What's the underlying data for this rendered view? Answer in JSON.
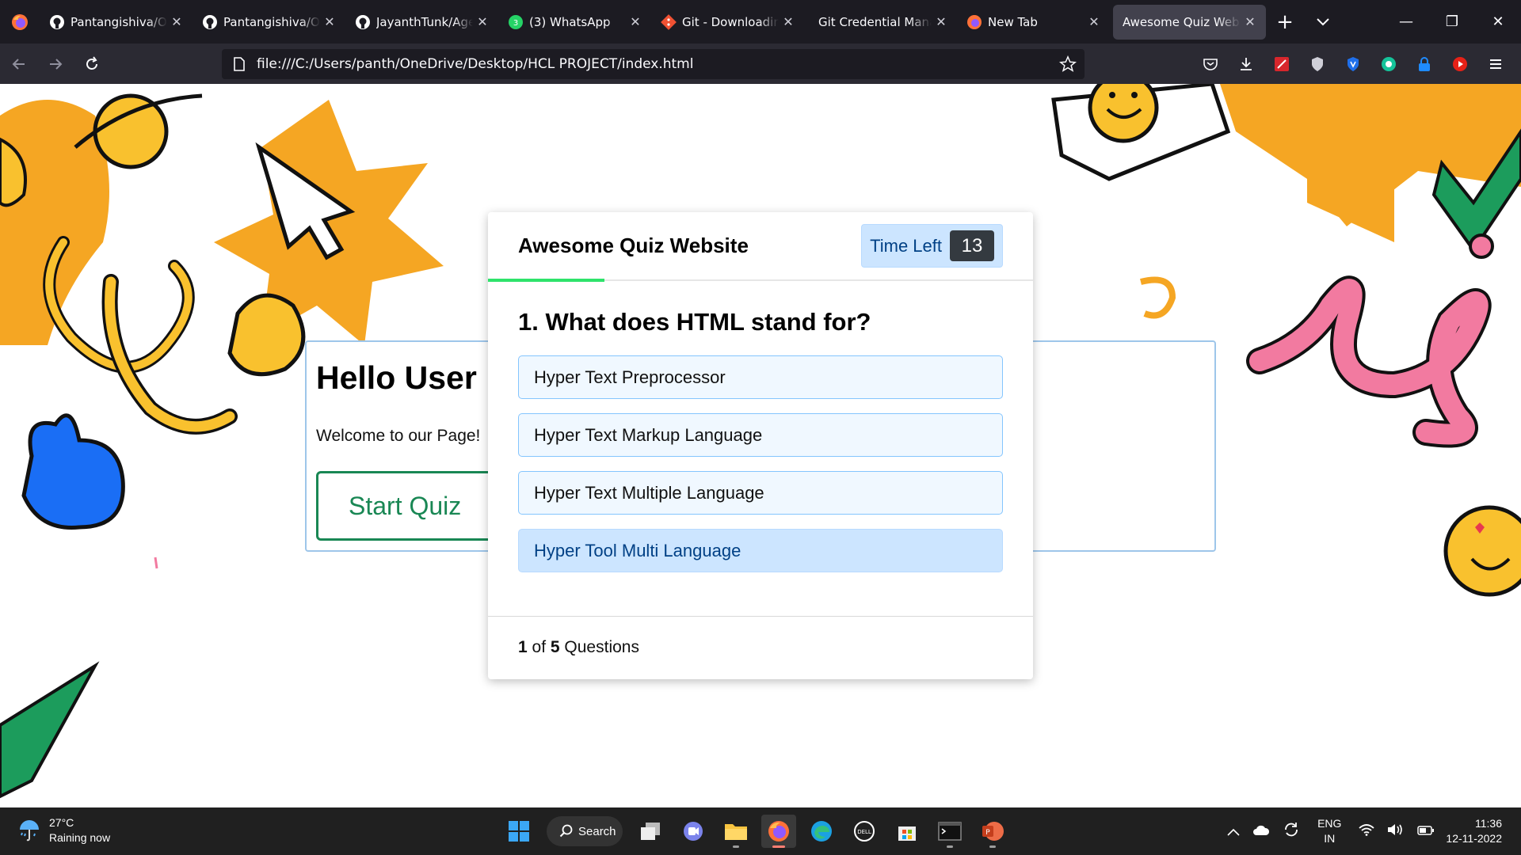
{
  "browser": {
    "tabs": [
      {
        "label": "Pantangishiva/Onl",
        "icon": "github-icon",
        "active": false
      },
      {
        "label": "Pantangishiva/Onl",
        "icon": "github-icon",
        "active": false
      },
      {
        "label": "JayanthTunk/Age",
        "icon": "github-icon",
        "active": false
      },
      {
        "label": "(3) WhatsApp",
        "icon": "whatsapp-icon",
        "active": false
      },
      {
        "label": "Git - Downloading",
        "icon": "git-icon",
        "active": false
      },
      {
        "label": "Git Credential Manage",
        "icon": "none",
        "active": false
      },
      {
        "label": "New Tab",
        "icon": "firefox-icon",
        "active": false
      },
      {
        "label": "Awesome Quiz Websit",
        "icon": "none",
        "active": true
      }
    ],
    "url": "file:///C:/Users/panth/OneDrive/Desktop/HCL PROJECT/index.html"
  },
  "page": {
    "hello_title": "Hello User",
    "welcome_text": "Welcome to our Page!",
    "start_button": "Start Quiz"
  },
  "quiz": {
    "title": "Awesome Quiz Website",
    "time_label": "Time Left",
    "time_left": "13",
    "question": "1. What does HTML stand for?",
    "options": [
      "Hyper Text Preprocessor",
      "Hyper Text Markup Language",
      "Hyper Text Multiple Language",
      "Hyper Tool Multi Language"
    ],
    "hovered_option": 3,
    "progress_current": "1",
    "progress_of": "of",
    "progress_total": "5",
    "progress_label": "Questions"
  },
  "taskbar": {
    "temperature": "27°C",
    "weather": "Raining now",
    "search_label": "Search",
    "lang_top": "ENG",
    "lang_bottom": "IN",
    "time": "11:36",
    "date": "12-11-2022"
  },
  "colors": {
    "accent_green": "#198754",
    "timer_bg": "#cce5ff",
    "time_line": "#2ee36b",
    "option_bg": "#f0f8ff"
  }
}
